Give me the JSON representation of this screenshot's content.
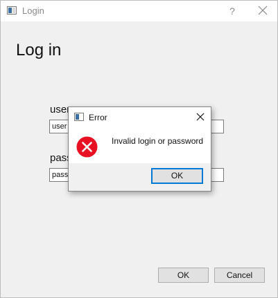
{
  "window": {
    "title": "Login",
    "help_glyph": "?",
    "icon": "app-window-icon",
    "close_icon": "close-icon"
  },
  "form": {
    "heading": "Log in",
    "username_label": "user",
    "username_value": "user",
    "password_label": "pass",
    "password_value": "pass",
    "ok_label": "OK",
    "cancel_label": "Cancel"
  },
  "dialog": {
    "title": "Error",
    "message": "Invalid login or password",
    "ok_label": "OK",
    "icon": "error-icon",
    "error_color": "#e81123",
    "focus_color": "#0078d7"
  }
}
